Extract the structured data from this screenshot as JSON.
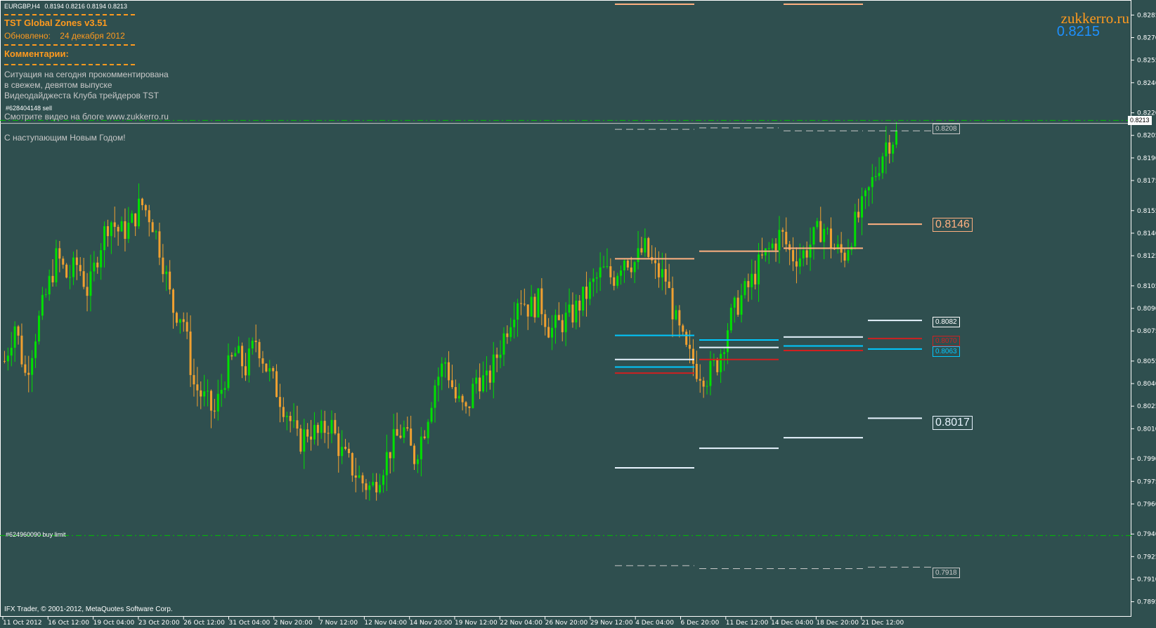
{
  "chart_header": {
    "symbol_timeframe": "EURGBP,H4",
    "ohlc": "0.8194 0.8216 0.8194 0.8213"
  },
  "info_panel": {
    "title": "TST Global Zones  v3.51",
    "updated_label": "Обновлено:",
    "updated_date": "24 декабря 2012",
    "comments_label": "Комментарии:",
    "comment_lines": [
      "Ситуация на сегодня прокомментирована",
      "в свежем, девятом выпуске",
      " Видеодайджеста Клуба трейдеров TST"
    ],
    "video_line": "Смотрите видео на блоге www.zukkerro.ru",
    "greeting": "С наступающим Новым Годом!"
  },
  "brand": {
    "site": "zukkerro.ru",
    "price": "0.8215"
  },
  "orders": {
    "sell": "#628404148 sell",
    "buy_limit": "#624960090 buy limit"
  },
  "footer": {
    "copyright": "IFX Trader, © 2001-2012, MetaQuotes Software Corp."
  },
  "price_tags": {
    "t8208": "0.8208",
    "t8146": "0.8146",
    "t8082": "0.8082",
    "t8070": "0.8070",
    "t8063": "0.8063",
    "t8017": "0.8017",
    "t7918": "0.7918",
    "current": "0.8213"
  },
  "colors": {
    "background": "#2f4f4f",
    "bull": "#00e000",
    "bear": "#f0a030",
    "orange_text": "#ff9a1e",
    "brand_blue": "#1e90ff",
    "zone_salmon": "#ffb080",
    "zone_white": "#e8f4ff",
    "zone_cyan": "#00c8ff",
    "zone_red": "#d02020",
    "order_line": "#00c000"
  },
  "chart_data": {
    "type": "candlestick",
    "symbol": "EURGBP",
    "timeframe": "H4",
    "price_axis": [
      "0.8285",
      "0.8270",
      "0.8255",
      "0.8240",
      "0.8220",
      "0.8205",
      "0.8190",
      "0.8175",
      "0.8155",
      "0.8140",
      "0.8125",
      "0.8105",
      "0.8090",
      "0.8075",
      "0.8055",
      "0.8040",
      "0.8025",
      "0.8010",
      "0.7990",
      "0.7975",
      "0.7960",
      "0.7940",
      "0.7925",
      "0.7910",
      "0.7895"
    ],
    "time_axis": [
      "11 Oct 2012",
      "16 Oct 12:00",
      "19 Oct 04:00",
      "23 Oct 20:00",
      "26 Oct 12:00",
      "31 Oct 04:00",
      "2 Nov 20:00",
      "7 Nov 12:00",
      "12 Nov 04:00",
      "14 Nov 20:00",
      "19 Nov 12:00",
      "22 Nov 04:00",
      "26 Nov 20:00",
      "29 Nov 12:00",
      "4 Dec 04:00",
      "6 Dec 20:00",
      "11 Dec 12:00",
      "14 Dec 04:00",
      "18 Dec 20:00",
      "21 Dec 12:00"
    ],
    "ylim": [
      0.7885,
      0.8295
    ],
    "close_path": [
      0.8055,
      0.808,
      0.8045,
      0.8075,
      0.81,
      0.8125,
      0.811,
      0.812,
      0.81,
      0.813,
      0.815,
      0.814,
      0.8145,
      0.816,
      0.815,
      0.8125,
      0.809,
      0.8085,
      0.804,
      0.803,
      0.802,
      0.8045,
      0.806,
      0.805,
      0.807,
      0.805,
      0.8035,
      0.802,
      0.8,
      0.801,
      0.8005,
      0.8015,
      0.7995,
      0.7985,
      0.7975,
      0.797,
      0.7985,
      0.8,
      0.801,
      0.799,
      0.801,
      0.804,
      0.8055,
      0.803,
      0.802,
      0.8045,
      0.804,
      0.806,
      0.808,
      0.81,
      0.809,
      0.8095,
      0.8075,
      0.808,
      0.8085,
      0.8095,
      0.8105,
      0.8115,
      0.811,
      0.8125,
      0.812,
      0.813,
      0.8115,
      0.811,
      0.808,
      0.806,
      0.805,
      0.8045,
      0.8055,
      0.808,
      0.8095,
      0.8105,
      0.812,
      0.813,
      0.814,
      0.8125,
      0.8125,
      0.8135,
      0.8145,
      0.813,
      0.8125,
      0.8145,
      0.816,
      0.818,
      0.82,
      0.8205
    ],
    "zones": [
      {
        "price": 0.8215,
        "style": "dash-dot",
        "color": "#00c000",
        "label": "#628404148 sell"
      },
      {
        "price": 0.7939,
        "style": "dash-dot",
        "color": "#00c000",
        "label": "#624960090 buy limit"
      },
      {
        "price": 0.8146,
        "color": "#ffb080",
        "label": "0.8146"
      },
      {
        "price": 0.8082,
        "color": "#e8f4ff",
        "label": "0.8082"
      },
      {
        "price": 0.807,
        "color": "#d02020",
        "label": "0.8070"
      },
      {
        "price": 0.8063,
        "color": "#00c8ff",
        "label": "0.8063"
      },
      {
        "price": 0.8017,
        "color": "#e8f4ff",
        "label": "0.8017"
      },
      {
        "price": 0.8208,
        "style": "dashed",
        "color": "#c8c8c8",
        "label": "0.8208"
      },
      {
        "price": 0.7918,
        "style": "dashed",
        "color": "#c8c8c8",
        "label": "0.7918"
      }
    ],
    "current_price": 0.8213
  }
}
